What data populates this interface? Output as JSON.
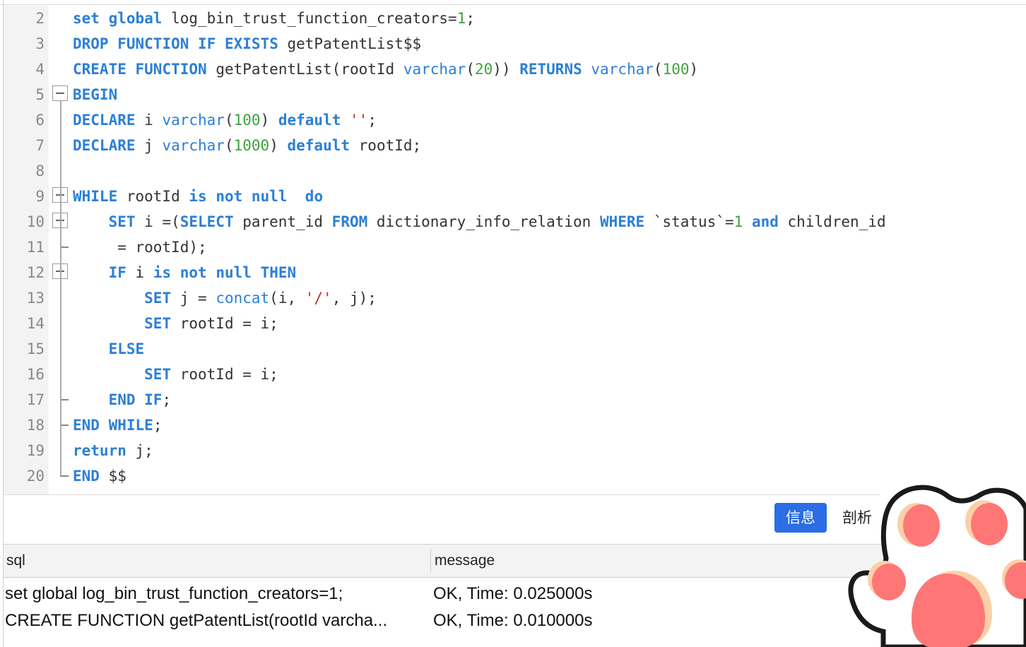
{
  "editor": {
    "lines": [
      {
        "n": "2",
        "fold": "",
        "html": "<span class=\"kw\">set</span> <span class=\"kw\">global</span> log_bin_trust_function_creators=<span class=\"num\">1</span>;"
      },
      {
        "n": "3",
        "fold": "",
        "html": "<span class=\"kw\">DROP</span> <span class=\"kw\">FUNCTION</span> <span class=\"kw\">IF</span> <span class=\"kw\">EXISTS</span> getPatentList$$"
      },
      {
        "n": "4",
        "fold": "",
        "html": "<span class=\"kw\">CREATE</span> <span class=\"kw\">FUNCTION</span> getPatentList(rootId <span class=\"fn\">varchar</span>(<span class=\"num\">20</span>)) <span class=\"kw\">RETURNS</span> <span class=\"fn\">varchar</span>(<span class=\"num\">100</span>)"
      },
      {
        "n": "5",
        "fold": "box",
        "html": "<span class=\"kw\">BEGIN</span>"
      },
      {
        "n": "6",
        "fold": "",
        "html": "<span class=\"kw\">DECLARE</span> i <span class=\"fn\">varchar</span>(<span class=\"num\">100</span>) <span class=\"kw\">default</span> <span class=\"str\">''</span>;"
      },
      {
        "n": "7",
        "fold": "",
        "html": "<span class=\"kw\">DECLARE</span> j <span class=\"fn\">varchar</span>(<span class=\"num\">1000</span>) <span class=\"kw\">default</span> rootId;"
      },
      {
        "n": "8",
        "fold": "",
        "html": ""
      },
      {
        "n": "9",
        "fold": "box",
        "html": "<span class=\"kw\">WHILE</span> rootId <span class=\"kw\">is</span> <span class=\"kw\">not</span> <span class=\"kw\">null</span>  <span class=\"kw\">do</span>"
      },
      {
        "n": "10",
        "fold": "box",
        "html": "    <span class=\"kw\">SET</span> i =(<span class=\"kw\">SELECT</span> parent_id <span class=\"kw\">FROM</span> dictionary_info_relation <span class=\"kw\">WHERE</span> `status`=<span class=\"num\">1</span> <span class=\"kw\">and</span> children_id"
      },
      {
        "n": "11",
        "fold": "end",
        "html": "     = rootId);"
      },
      {
        "n": "12",
        "fold": "box",
        "html": "    <span class=\"kw\">IF</span> i <span class=\"kw\">is</span> <span class=\"kw\">not</span> <span class=\"kw\">null</span> <span class=\"kw\">THEN</span>"
      },
      {
        "n": "13",
        "fold": "",
        "html": "        <span class=\"kw\">SET</span> j = <span class=\"fn\">concat</span>(i, <span class=\"str\">'/'</span>, j);"
      },
      {
        "n": "14",
        "fold": "",
        "html": "        <span class=\"kw\">SET</span> rootId = i;"
      },
      {
        "n": "15",
        "fold": "",
        "html": "    <span class=\"kw\">ELSE</span>"
      },
      {
        "n": "16",
        "fold": "",
        "html": "        <span class=\"kw\">SET</span> rootId = i;"
      },
      {
        "n": "17",
        "fold": "end",
        "html": "    <span class=\"kw\">END</span> <span class=\"kw\">IF</span>;"
      },
      {
        "n": "18",
        "fold": "end",
        "html": "<span class=\"kw\">END</span> <span class=\"kw\">WHILE</span>;"
      },
      {
        "n": "19",
        "fold": "",
        "html": "<span class=\"kw\">return</span> j;"
      },
      {
        "n": "20",
        "fold": "end",
        "html": "<span class=\"kw\">END</span> $$"
      }
    ]
  },
  "tabs": {
    "info": "信息",
    "profile": "剖析"
  },
  "results": {
    "columns": [
      "sql",
      "message"
    ],
    "rows": [
      [
        "set global log_bin_trust_function_creators=1;",
        "OK, Time: 0.025000s"
      ],
      [
        "CREATE FUNCTION getPatentList(rootId varcha...",
        "OK, Time: 0.010000s"
      ]
    ]
  },
  "colors": {
    "keyword": "#2c7fd6",
    "number": "#3ca23c",
    "string": "#cc2b2b",
    "accent": "#2a6de4"
  }
}
